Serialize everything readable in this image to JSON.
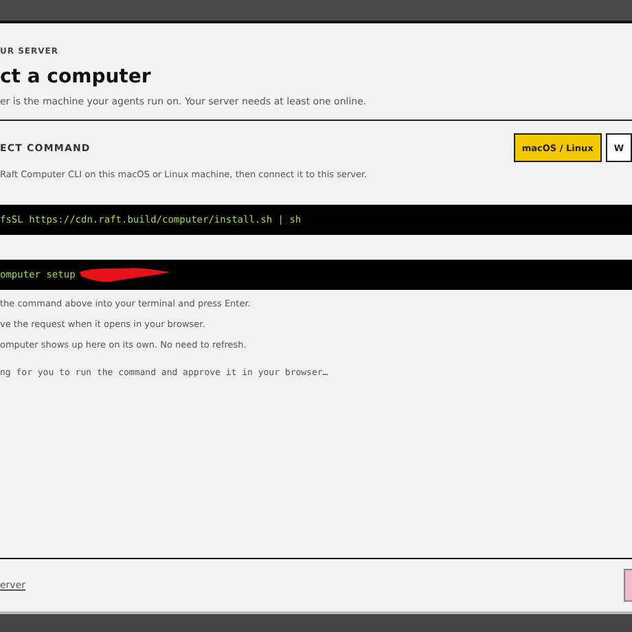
{
  "eyebrow": "UR SERVER",
  "title": "ct a computer",
  "subtitle": "er is the machine your agents run on. Your server needs at least one online.",
  "section": {
    "heading": "ECT COMMAND",
    "platform_tabs": [
      {
        "label": "macOS / Linux",
        "selected": true
      },
      {
        "label": "W",
        "selected": false
      }
    ],
    "description": "Raft Computer CLI on this macOS or Linux machine, then connect it to this server."
  },
  "commands": [
    {
      "text": "fsSL https://cdn.raft.build/computer/install.sh | sh",
      "redacted": false
    },
    {
      "text": "omputer setup ",
      "redacted": true
    }
  ],
  "steps": [
    "the command above into your terminal and press Enter.",
    "ve the request when it opens in your browser.",
    "omputer shows up here on its own. No need to refresh."
  ],
  "status": "ng for you to run the command and approve it in your browser…",
  "footer": {
    "link": "erver"
  }
}
